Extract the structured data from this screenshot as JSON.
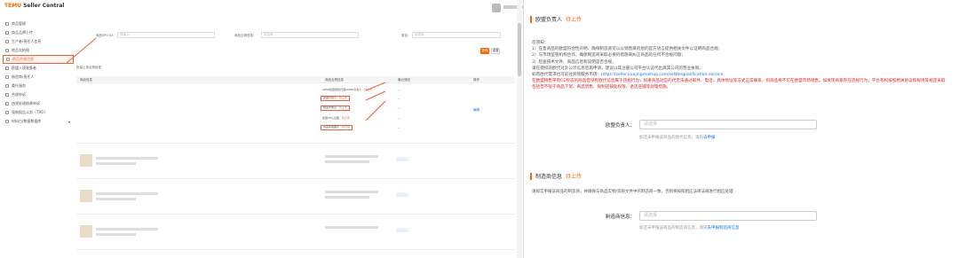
{
  "app": {
    "brand_prefix": "TEMU",
    "brand_suffix": "Seller Central"
  },
  "sidebar": {
    "items": [
      {
        "label": "商品管理"
      },
      {
        "label": "商品品牌上传"
      },
      {
        "label": "生产者/责任人信息"
      },
      {
        "label": "商品实拍图"
      },
      {
        "label": "商品合规信息"
      },
      {
        "label": "欧盟入境准备者"
      },
      {
        "label": "制造商/责任人"
      },
      {
        "label": "委托服务"
      },
      {
        "label": "合规申诉"
      },
      {
        "label": "违规处理结果申诉"
      },
      {
        "label": "强制报告义务（TRO）"
      },
      {
        "label": "材料白/数据数据库"
      }
    ]
  },
  "filters": {
    "f1_label": "商品SPU ID：",
    "f1_placeholder": "请输入",
    "f2_label": "商品合规信息：",
    "f2_placeholder": "请选择",
    "f3_label": "类目：",
    "f3_placeholder": "请选择",
    "query": "查询",
    "reset": "重置"
  },
  "table": {
    "hint": "批量上传合规信息",
    "headers": [
      "商品信息",
      "商品合规信息",
      "最近驳回",
      "操作"
    ],
    "tags": [
      {
        "text": "GPSR欧盟授权代理/GPSR负责人",
        "status": "待上传"
      },
      {
        "text": "欧盟负责人",
        "status": "待上传"
      },
      {
        "text": "制造商信息",
        "status": "待上传"
      },
      {
        "text": "欧盟CE认证图",
        "status": "待上传"
      },
      {
        "text": "商品实拍图片",
        "status": "待上传"
      }
    ],
    "dash": "--",
    "op": "编辑"
  },
  "eu_section": {
    "title": "欧盟负责人",
    "badge": "待上传",
    "intro": "您须知：",
    "l1": "1）在售商品的欧盟符合性声明、确保制造商可以以销售目的地的官方语言提供相关文件以证明商品合规；",
    "l2": "2）与市场监管机构合作，确保制造商采取必要的措施来纠正商品的任何不合规问题；",
    "l3": "3）检查技术文件、商品信息和说明是否合规。",
    "l4": "请在授权的欧代对外公示信息后再申请，建议以其注册公司平台认证代出具其公司的营业执照。",
    "l5_prefix": "如有欧代需求也可前往跨境服务市场：",
    "l5_link": "https://seller.kuajingmaihuo.com/settle/qualification-service",
    "warn": "在欧盟销售带有CE标志的商品但没有欧代信息属于违规行为，如果商品对应的代无法通过邮件、电话、具体地址等方式正常联系，则商品将不可在欧盟市场销售。如发现商家存在违规行为，平台有权按照相关协议和规则等规定采取包括但不限于商品下架、商品禁售、限制店铺处权限、退店店铺等处理措施。",
    "field_label": "欧盟负责人：",
    "field_placeholder": "请选择",
    "help_prefix": "如还未申报该商品的欧代信息，请先",
    "help_link": "去申报"
  },
  "mfr_section": {
    "title": "制造商信息",
    "badge": "待上传",
    "desc": "请如实申报该商品的制造商，并确保与商品实物/资质文件中的制造商一致，否则将按照相应法律法规进行相应处理",
    "field_label": "制造商信息：",
    "field_placeholder": "请选择",
    "help_prefix": "如还未申报该商品的制造商信息，请先",
    "help_link": "去申报制造商信息"
  },
  "colors": {
    "accent": "#f60",
    "highlight": "#e8633a",
    "link": "#1677ff",
    "warning": "#e02020"
  }
}
